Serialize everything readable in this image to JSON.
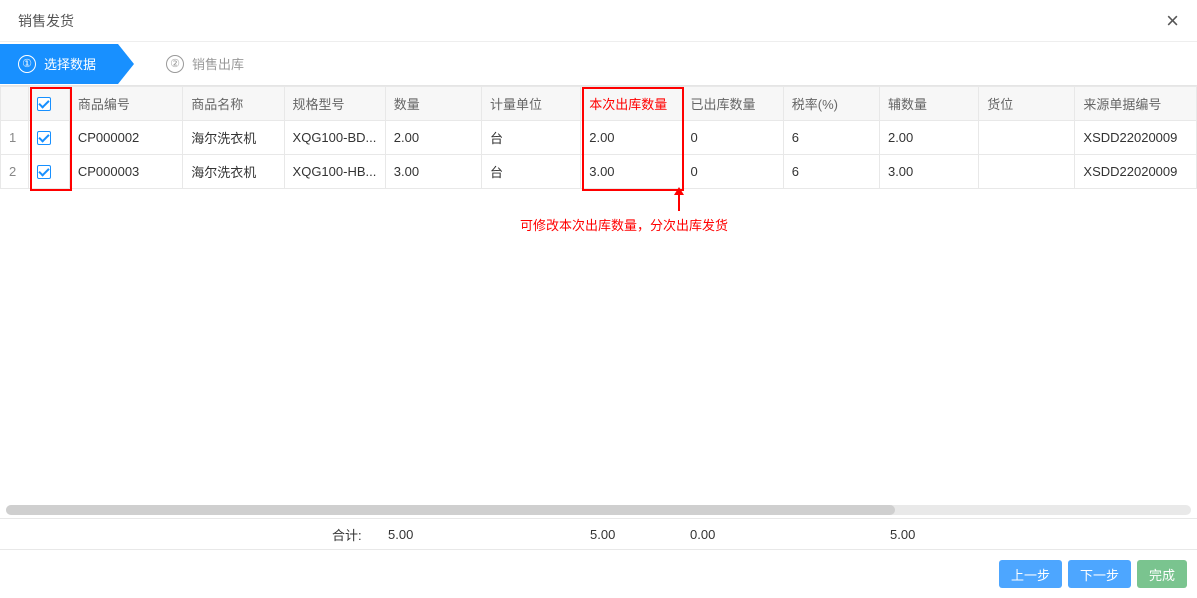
{
  "dialog": {
    "title": "销售发货"
  },
  "steps": [
    {
      "num": "①",
      "label": "选择数据",
      "active": true
    },
    {
      "num": "②",
      "label": "销售出库",
      "active": false
    }
  ],
  "columns": {
    "code": "商品编号",
    "name": "商品名称",
    "model": "规格型号",
    "qty": "数量",
    "unit": "计量单位",
    "outqty": "本次出库数量",
    "already": "已出库数量",
    "rate": "税率(%)",
    "aux": "辅数量",
    "loc": "货位",
    "src": "来源单据编号"
  },
  "rows": [
    {
      "idx": "1",
      "checked": true,
      "code": "CP000002",
      "name": "海尔洗衣机",
      "model": "XQG100-BD...",
      "qty": "2.00",
      "unit": "台",
      "outqty": "2.00",
      "already": "0",
      "rate": "6",
      "aux": "2.00",
      "loc": "",
      "src": "XSDD22020009"
    },
    {
      "idx": "2",
      "checked": true,
      "code": "CP000003",
      "name": "海尔洗衣机",
      "model": "XQG100-HB...",
      "qty": "3.00",
      "unit": "台",
      "outqty": "3.00",
      "already": "0",
      "rate": "6",
      "aux": "3.00",
      "loc": "",
      "src": "XSDD22020009"
    }
  ],
  "annotation": "可修改本次出库数量，分次出库发货",
  "totals": {
    "label": "合计:",
    "qty": "5.00",
    "outqty": "5.00",
    "already": "0.00",
    "aux": "5.00"
  },
  "buttons": {
    "prev": "上一步",
    "next": "下一步",
    "done": "完成"
  }
}
